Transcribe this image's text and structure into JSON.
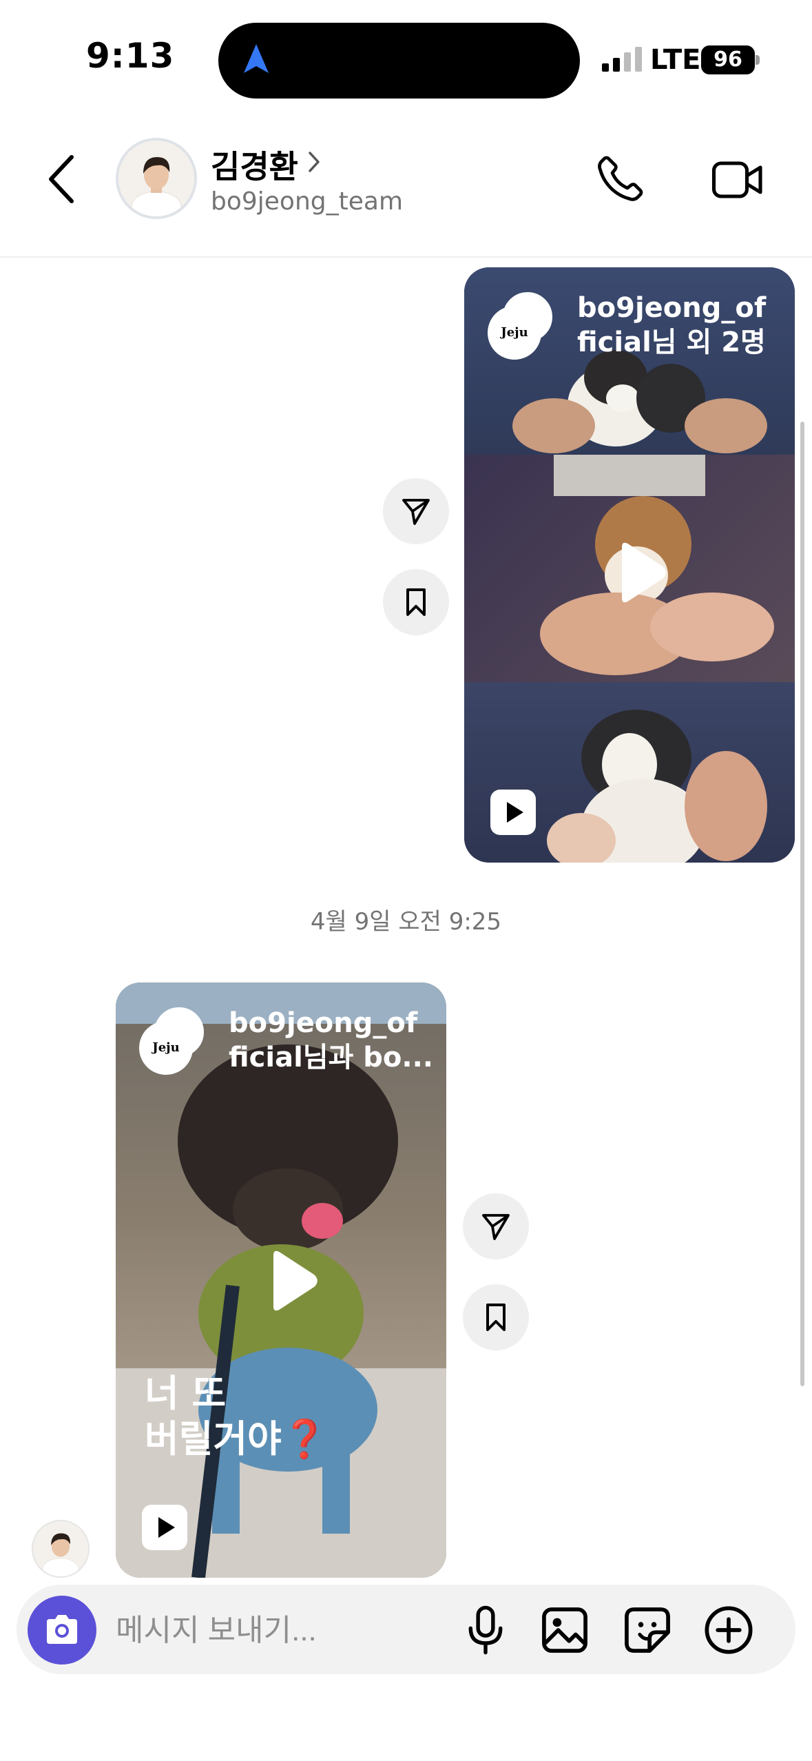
{
  "status_bar": {
    "time": "9:13",
    "network": "LTE",
    "battery": "96"
  },
  "header": {
    "name": "김경환",
    "username": "bo9jeong_team"
  },
  "messages": {
    "card1": {
      "author": "bo9jeong_official님 외 2명",
      "author_line1": "bo9jeong_of",
      "author_line2": "ficial님 외 2명",
      "avatar_text": "Jeju"
    },
    "timestamp": "4월 9일 오전 9:25",
    "card2": {
      "author_line1": "bo9jeong_of",
      "author_line2": "ficial님과 bo...",
      "avatar_text": "Jeju",
      "caption_line1": "너 또",
      "caption_line2": "버릴거야❓"
    }
  },
  "composer": {
    "placeholder": "메시지 보내기..."
  },
  "colors": {
    "accent": "#5b51d8",
    "secondary_text": "#737373",
    "bubble_bg": "#efefef",
    "link_blue": "#3478f6"
  },
  "icons": [
    "back-icon",
    "chevron-right-icon",
    "phone-icon",
    "video-call-icon",
    "share-icon",
    "bookmark-icon",
    "play-icon",
    "reels-icon",
    "camera-icon",
    "mic-icon",
    "gallery-icon",
    "sticker-icon",
    "plus-circle-icon",
    "location-arrow-icon"
  ]
}
